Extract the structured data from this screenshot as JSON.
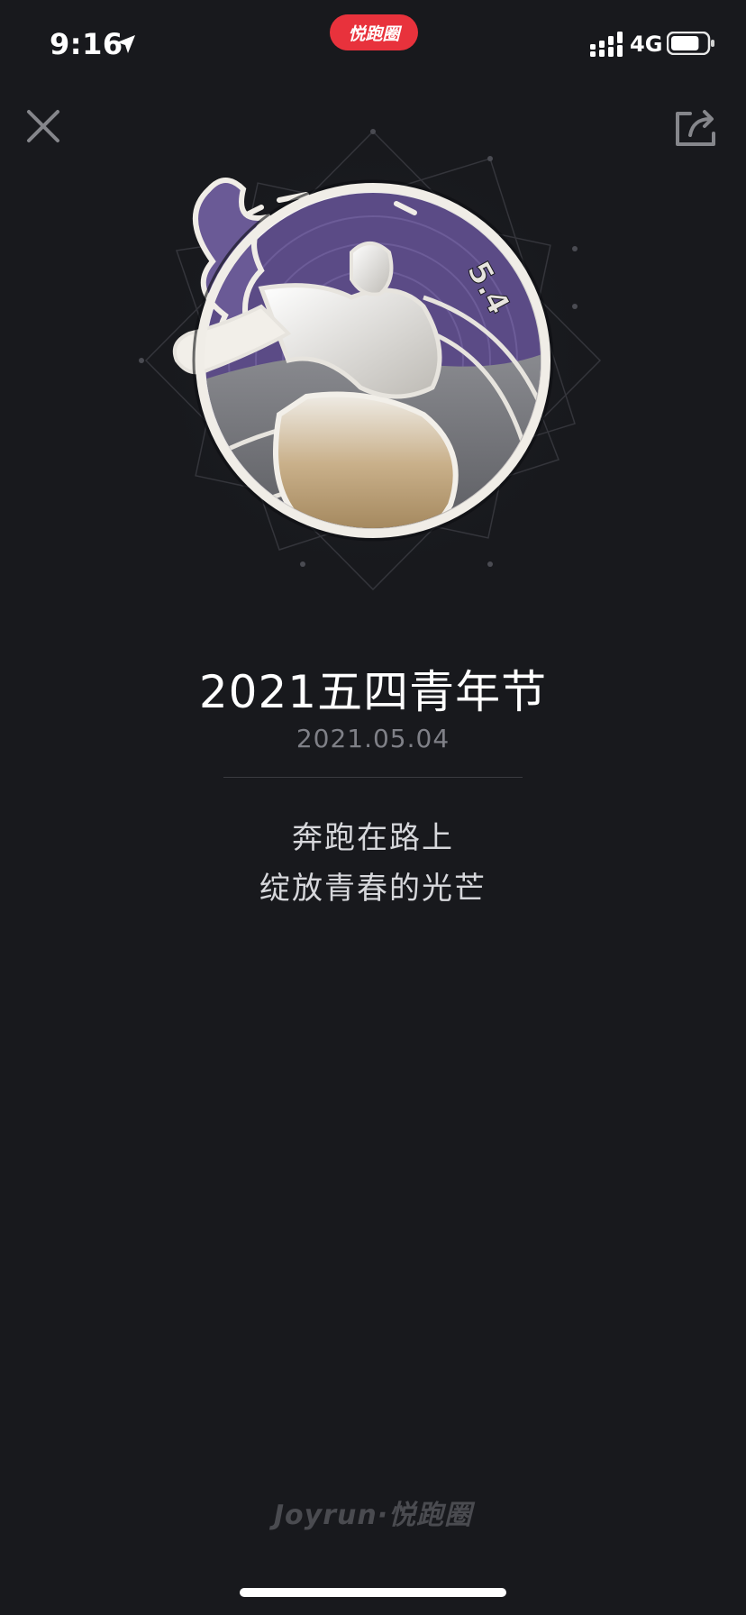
{
  "status_bar": {
    "time": "9:16",
    "app_pill_label": "悦跑圈",
    "network": "4G",
    "battery_level_percent": 80
  },
  "icons": {
    "close": "close-icon",
    "share": "share-icon",
    "location": "location-arrow-icon",
    "signal": "signal-icon",
    "battery": "battery-icon"
  },
  "badge": {
    "number_text": "5.4",
    "colors": {
      "purple": "#5b4b86",
      "silver": "#e7e4de",
      "gold": "#bfa272",
      "gray": "#6f7075"
    }
  },
  "medal": {
    "title": "2021五四青年节",
    "date": "2021.05.04",
    "slogan_line1": "奔跑在路上",
    "slogan_line2": "绽放青春的光芒"
  },
  "footer": {
    "brand": "Joyrun·悦跑圈"
  },
  "colors": {
    "background": "#18191d",
    "accent_red": "#e8323c",
    "date_gray": "#7f8087"
  }
}
